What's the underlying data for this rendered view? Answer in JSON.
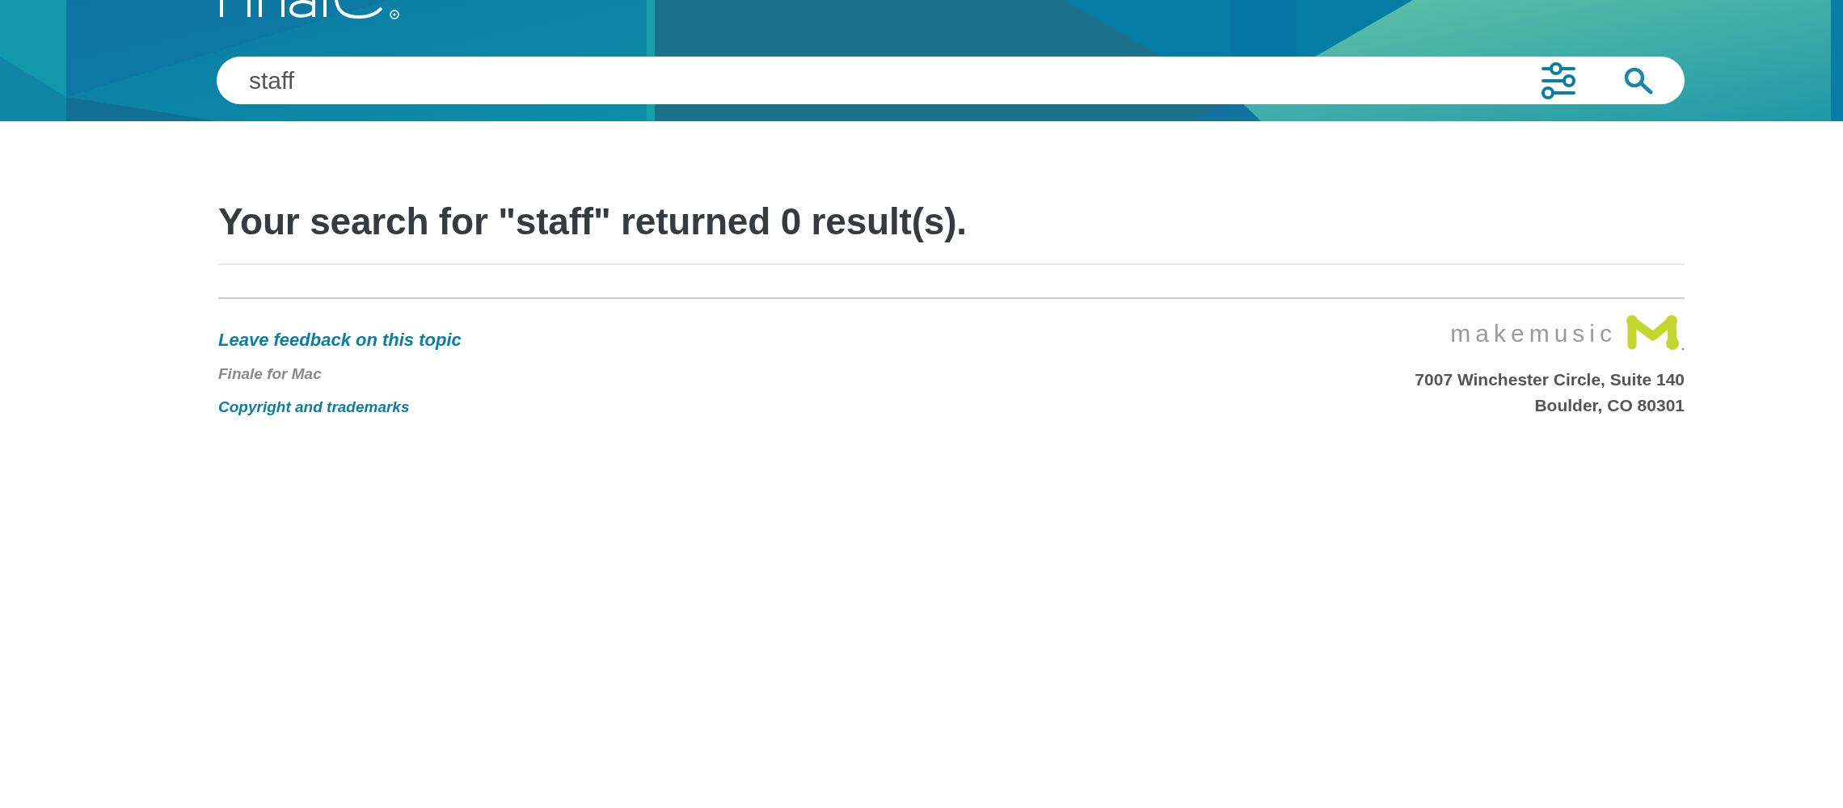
{
  "search": {
    "value": "staff"
  },
  "results": {
    "heading": "Your search for \"staff\" returned 0 result(s)."
  },
  "footer": {
    "feedback_link": "Leave feedback on this topic",
    "product": "Finale for Mac",
    "copyright_link": "Copyright and trademarks",
    "brand": "makemusic",
    "address": [
      "7007 Winchester Circle, Suite 140",
      "Boulder, CO 80301"
    ]
  }
}
